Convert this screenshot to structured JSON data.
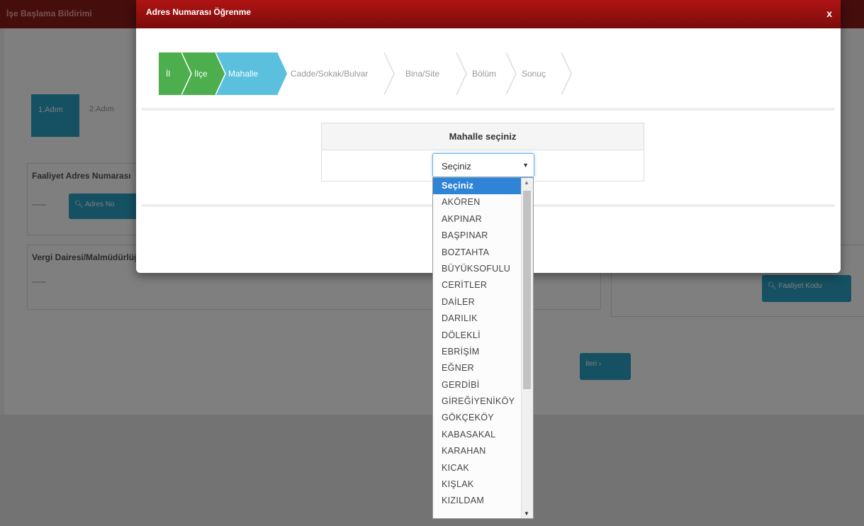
{
  "background": {
    "header_title": "İşe Başlama Bildirimi",
    "step1": "1.Adım",
    "step2": "2.Adım",
    "field1_label": "Faaliyet Adres Numarası",
    "field1_value": "-----",
    "field1_button": "Adres No",
    "field2_label": "Vergi Dairesi/Malmüdürlüğü",
    "field2_value": "-----",
    "faaliyet_button": "Faaliyet Kodu",
    "next_button": "İleri"
  },
  "modal": {
    "title": "Adres Numarası Öğrenme",
    "close": "x",
    "steps": [
      {
        "label": "İl",
        "state": "done"
      },
      {
        "label": "İlçe",
        "state": "done"
      },
      {
        "label": "Mahalle",
        "state": "active"
      },
      {
        "label": "Cadde/Sokak/Bulvar",
        "state": "future"
      },
      {
        "label": "Bina/Site",
        "state": "future"
      },
      {
        "label": "Bölüm",
        "state": "future"
      },
      {
        "label": "Sonuç",
        "state": "future"
      }
    ],
    "panel_title": "Mahalle seçiniz",
    "select_value": "Seçiniz"
  },
  "dropdown": {
    "options": [
      "Seçiniz",
      "AKÖREN",
      "AKPINAR",
      "BAŞPINAR",
      "BOZTAHTA",
      "BÜYÜKSOFULU",
      "CERİTLER",
      "DAİLER",
      "DARILIK",
      "DÖLEKLİ",
      "EBRİŞİM",
      "EĞNER",
      "GERDİBİ",
      "GİREĞİYENİKÖY",
      "GÖKÇEKÖY",
      "KABASAKAL",
      "KARAHAN",
      "KICAK",
      "KIŞLAK",
      "KIZILDAM"
    ],
    "selected_index": 0
  },
  "colors": {
    "header": "#8c1a1a",
    "done": "#4cae4c",
    "active": "#5bc0de",
    "selected": "#2f84d6"
  }
}
